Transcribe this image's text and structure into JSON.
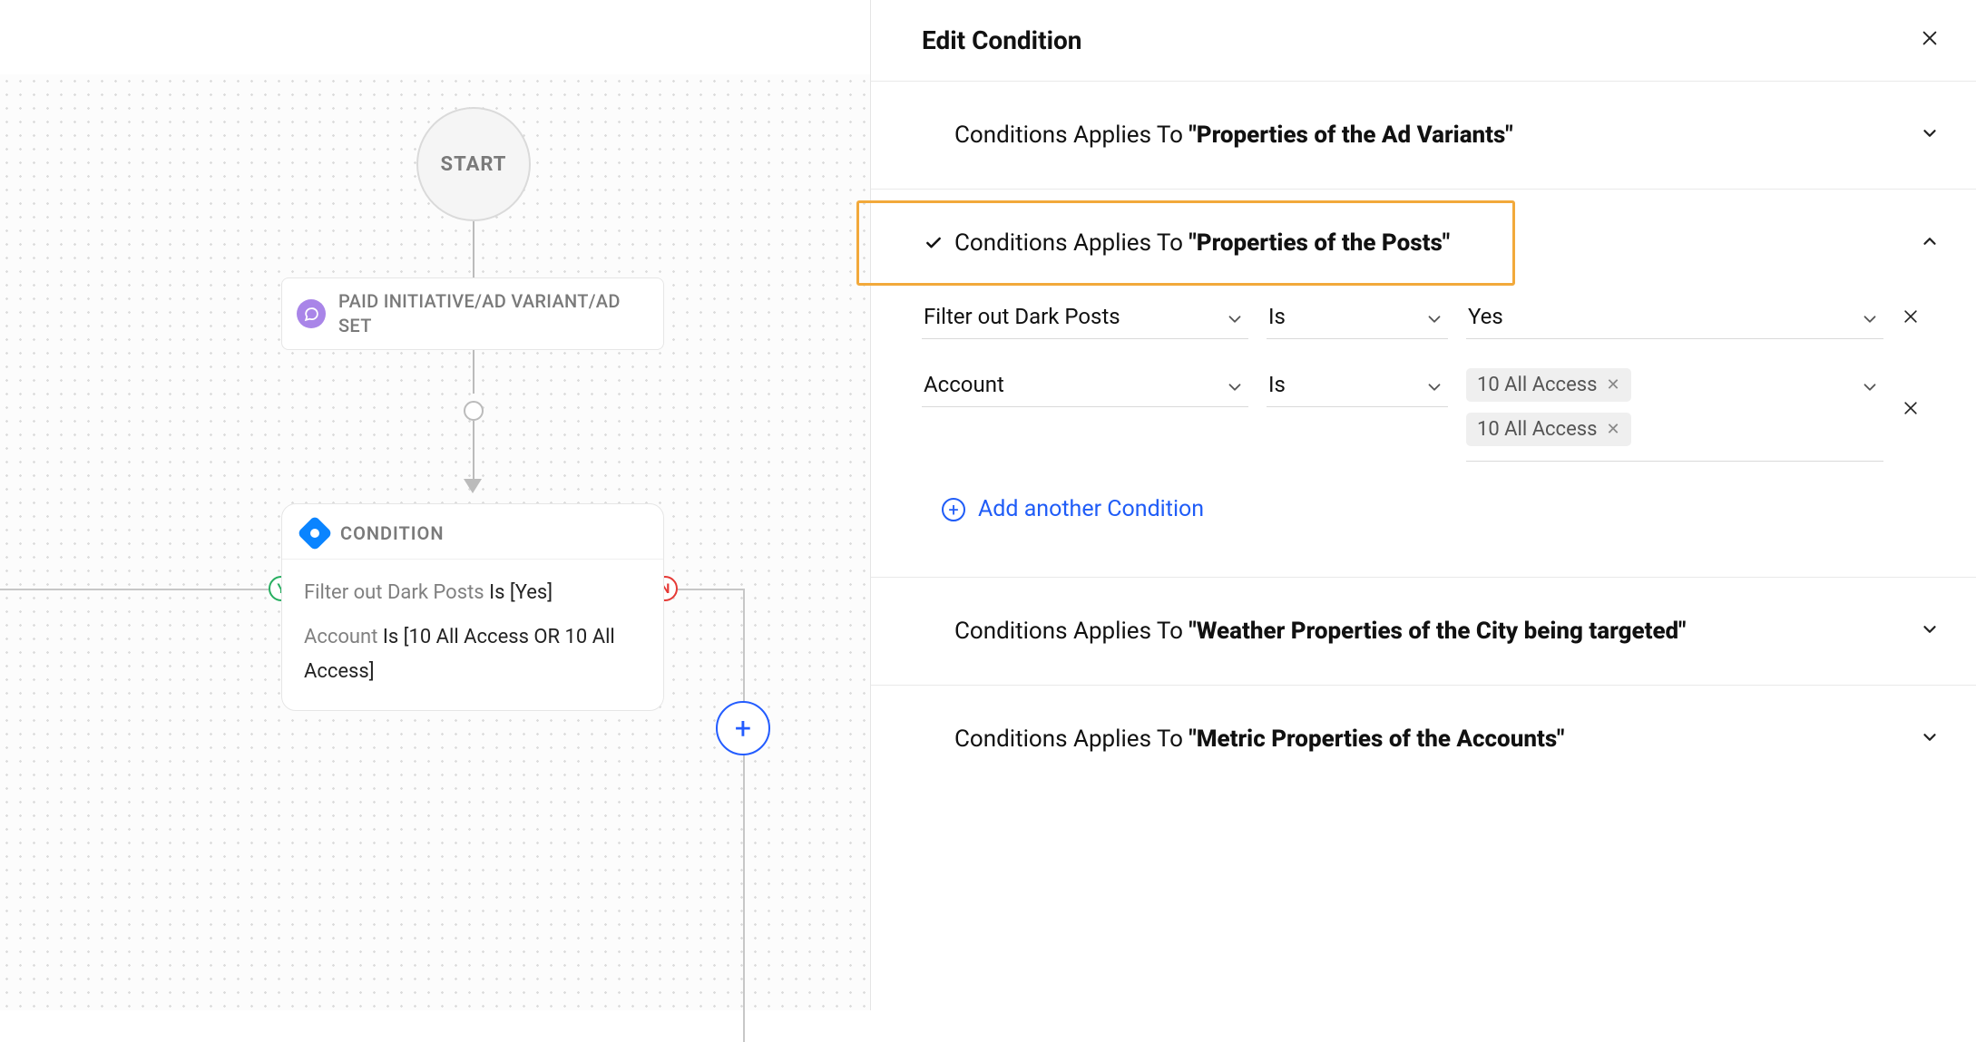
{
  "canvas": {
    "start_label": "START",
    "trigger_label": "PAID INITIATIVE/AD VARIANT/AD SET",
    "condition": {
      "title": "CONDITION",
      "line1_prefix": "Filter out Dark Posts",
      "line1_suffix": " Is [Yes]",
      "line2_prefix": "Account",
      "line2_suffix": " Is [10 All Access OR 10 All Access]"
    },
    "badges": {
      "yes": "Y",
      "no": "N"
    }
  },
  "panel": {
    "title": "Edit Condition",
    "sections": [
      {
        "label_prefix": "Conditions Applies To ",
        "label_bold": "\"Properties of the Ad Variants\"",
        "checked": false,
        "expanded": false
      },
      {
        "label_prefix": "Conditions Applies To ",
        "label_bold": "\"Properties of the Posts\"",
        "checked": true,
        "expanded": true,
        "rows": [
          {
            "field": "Filter out Dark Posts",
            "operator": "Is",
            "value": "Yes",
            "tags": null
          },
          {
            "field": "Account",
            "operator": "Is",
            "value": null,
            "tags": [
              "10 All Access",
              "10 All Access"
            ]
          }
        ],
        "add_label": "Add another Condition"
      },
      {
        "label_prefix": "Conditions Applies To ",
        "label_bold": "\"Weather Properties of the City being targeted\"",
        "checked": false,
        "expanded": false
      },
      {
        "label_prefix": "Conditions Applies To ",
        "label_bold": "\"Metric Properties of the Accounts\"",
        "checked": false,
        "expanded": false
      }
    ]
  }
}
